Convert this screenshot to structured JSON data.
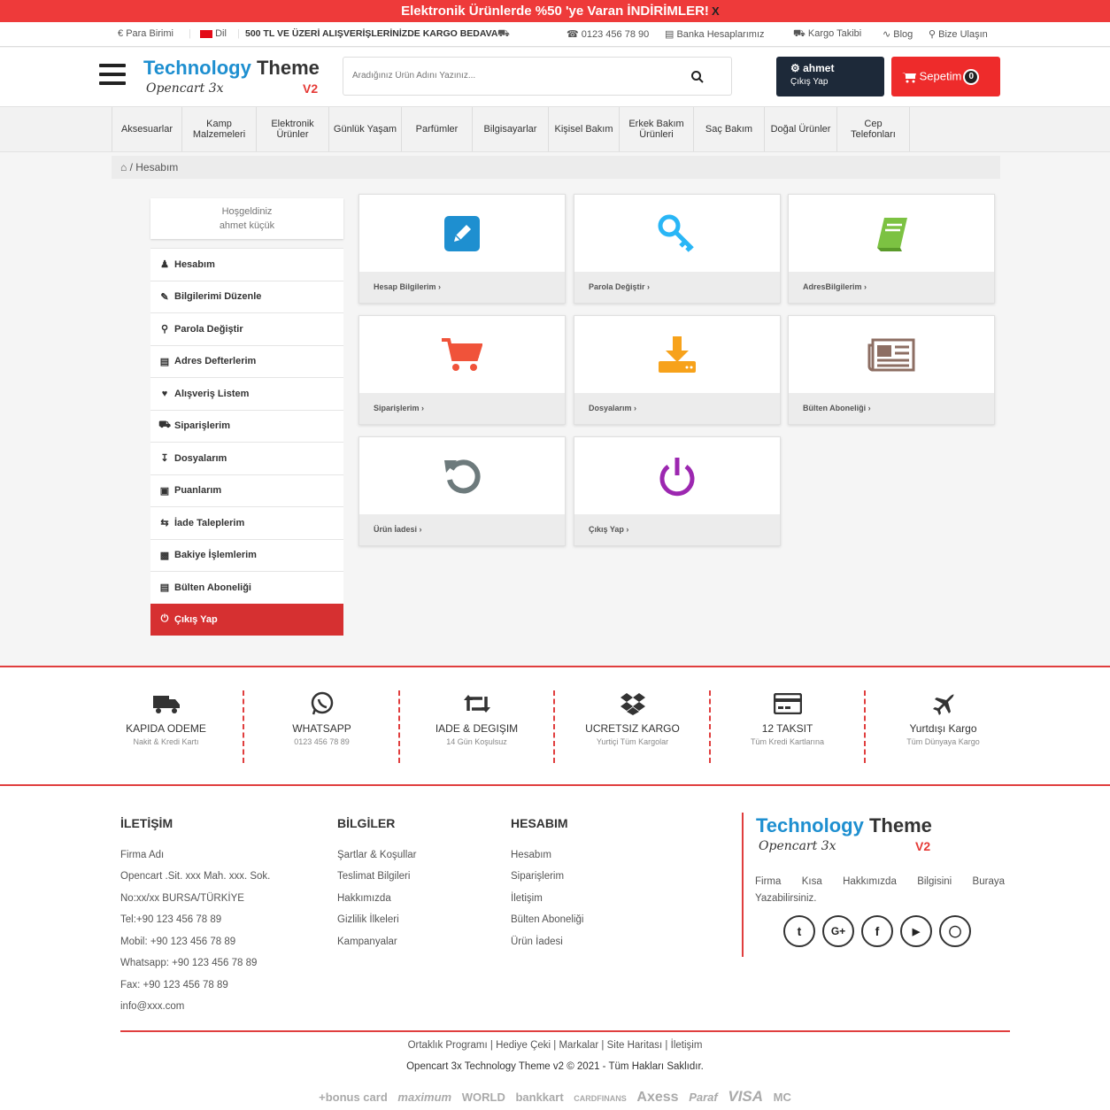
{
  "promo": {
    "text": "Elektronik Ürünlerde %50 'ye Varan İNDİRİMLER!",
    "close": "X"
  },
  "topbar": {
    "currency": "Para Birimi",
    "language": "Dil",
    "shipping_note": "500 TL VE ÜZERİ ALIŞVERİŞLERİNİZDE KARGO BEDAVA",
    "phone": "0123 456 78 90",
    "bank": "Banka Hesaplarımız",
    "tracking": "Kargo Takibi",
    "blog": "Blog",
    "contact": "Bize Ulaşın"
  },
  "logo": {
    "title_blue": "Technology",
    "title_dark": "Theme",
    "subtitle": "Opencart 3x",
    "version": "V2"
  },
  "search": {
    "placeholder": "Aradığınız Ürün Adını Yazınız..."
  },
  "user": {
    "name": "ahmet",
    "logout": "Çıkış Yap"
  },
  "cart": {
    "label": "Sepetim",
    "count": "0"
  },
  "menu": [
    "Aksesuarlar",
    "Kamp Malzemeleri",
    "Elektronik Ürünler",
    "Günlük Yaşam",
    "Parfümler",
    "Bilgisayarlar",
    "Kişisel Bakım",
    "Erkek Bakım Ürünleri",
    "Saç Bakım",
    "Doğal Ürünler",
    "Cep Telefonları"
  ],
  "breadcrumb": {
    "current": "Hesabım"
  },
  "sidebar": {
    "welcome": "Hoşgeldiniz",
    "username": "ahmet küçük",
    "items": [
      {
        "label": "Hesabım",
        "icon": "user-icon"
      },
      {
        "label": "Bilgilerimi Düzenle",
        "icon": "edit-icon"
      },
      {
        "label": "Parola Değiştir",
        "icon": "key-icon"
      },
      {
        "label": "Adres Defterlerim",
        "icon": "book-icon"
      },
      {
        "label": "Alışveriş Listem",
        "icon": "heart-icon"
      },
      {
        "label": "Siparişlerim",
        "icon": "cart-icon"
      },
      {
        "label": "Dosyalarım",
        "icon": "download-icon"
      },
      {
        "label": "Puanlarım",
        "icon": "gift-icon"
      },
      {
        "label": "İade Taleplerim",
        "icon": "retweet-icon"
      },
      {
        "label": "Bakiye İşlemlerim",
        "icon": "money-icon"
      },
      {
        "label": "Bülten Aboneliği",
        "icon": "newspaper-icon"
      },
      {
        "label": "Çıkış Yap",
        "icon": "power-icon"
      }
    ]
  },
  "cards": [
    {
      "label": "Hesap Bilgilerim",
      "icon": "edit-icon",
      "color": "#1e8fd0"
    },
    {
      "label": "Parola Değiştir",
      "icon": "key-icon",
      "color": "#29b6f6"
    },
    {
      "label": "AdresBilgilerim",
      "icon": "book-icon",
      "color": "#7cc242"
    },
    {
      "label": "Siparişlerim",
      "icon": "cart-icon",
      "color": "#f0533a"
    },
    {
      "label": "Dosyalarım",
      "icon": "download-icon",
      "color": "#f7a21b"
    },
    {
      "label": "Bülten Aboneliği",
      "icon": "newspaper-icon",
      "color": "#8d6e63"
    },
    {
      "label": "Ürün İadesi",
      "icon": "undo-icon",
      "color": "#6d7a7c"
    },
    {
      "label": "Çıkış Yap",
      "icon": "power-icon",
      "color": "#9c27b0"
    }
  ],
  "features": [
    {
      "title": "KAPIDA ODEME",
      "sub": "Nakit & Kredi Kartı",
      "icon": "truck-icon"
    },
    {
      "title": "WHATSAPP",
      "sub": "0123 456 78 89",
      "icon": "whatsapp-icon"
    },
    {
      "title": "IADE & DEGIŞIM",
      "sub": "14 Gün Koşulsuz",
      "icon": "retweet-icon"
    },
    {
      "title": "UCRETSIZ KARGO",
      "sub": "Yurtiçi Tüm Kargolar",
      "icon": "dropbox-icon"
    },
    {
      "title": "12 TAKSIT",
      "sub": "Tüm Kredi Kartlarına",
      "icon": "credit-card-icon"
    },
    {
      "title": "Yurtdışı Kargo",
      "sub": "Tüm Dünyaya Kargo",
      "icon": "plane-icon"
    }
  ],
  "footer": {
    "contact": {
      "title": "İLETİŞİM",
      "lines": [
        "Firma Adı",
        "Opencart .Sit. xxx Mah. xxx. Sok.",
        "No:xx/xx BURSA/TÜRKİYE",
        "Tel:+90 123 456 78 89",
        "Mobil: +90 123 456 78 89",
        "Whatsapp: +90 123 456 78 89",
        "Fax: +90 123 456 78 89",
        "info@xxx.com"
      ]
    },
    "info": {
      "title": "BİLGİLER",
      "lines": [
        "Şartlar & Koşullar",
        "Teslimat Bilgileri",
        "Hakkımızda",
        "Gizlilik İlkeleri",
        "Kampanyalar"
      ]
    },
    "account": {
      "title": "HESABIM",
      "lines": [
        "Hesabım",
        "Siparişlerim",
        "İletişim",
        "Bülten Aboneliği",
        "Ürün İadesi"
      ]
    },
    "about": "Firma Kısa Hakkımızda Bilgisini Buraya Yazabilirsiniz.",
    "social": [
      "twitter-icon",
      "google-plus-icon",
      "facebook-icon",
      "youtube-icon",
      "instagram-icon"
    ],
    "links": [
      "Ortaklık Programı",
      "Hediye Çeki",
      "Markalar",
      "Site Haritası",
      "İletişim"
    ],
    "copyright": "Opencart 3x Technology Theme v2 © 2021 - Tüm Hakları Saklıdır.",
    "payments": [
      "+bonus card",
      "maximum",
      "WORLD",
      "bankkart",
      "CARDFINANS",
      "Axess",
      "Paraf",
      "VISA",
      "MC"
    ]
  }
}
